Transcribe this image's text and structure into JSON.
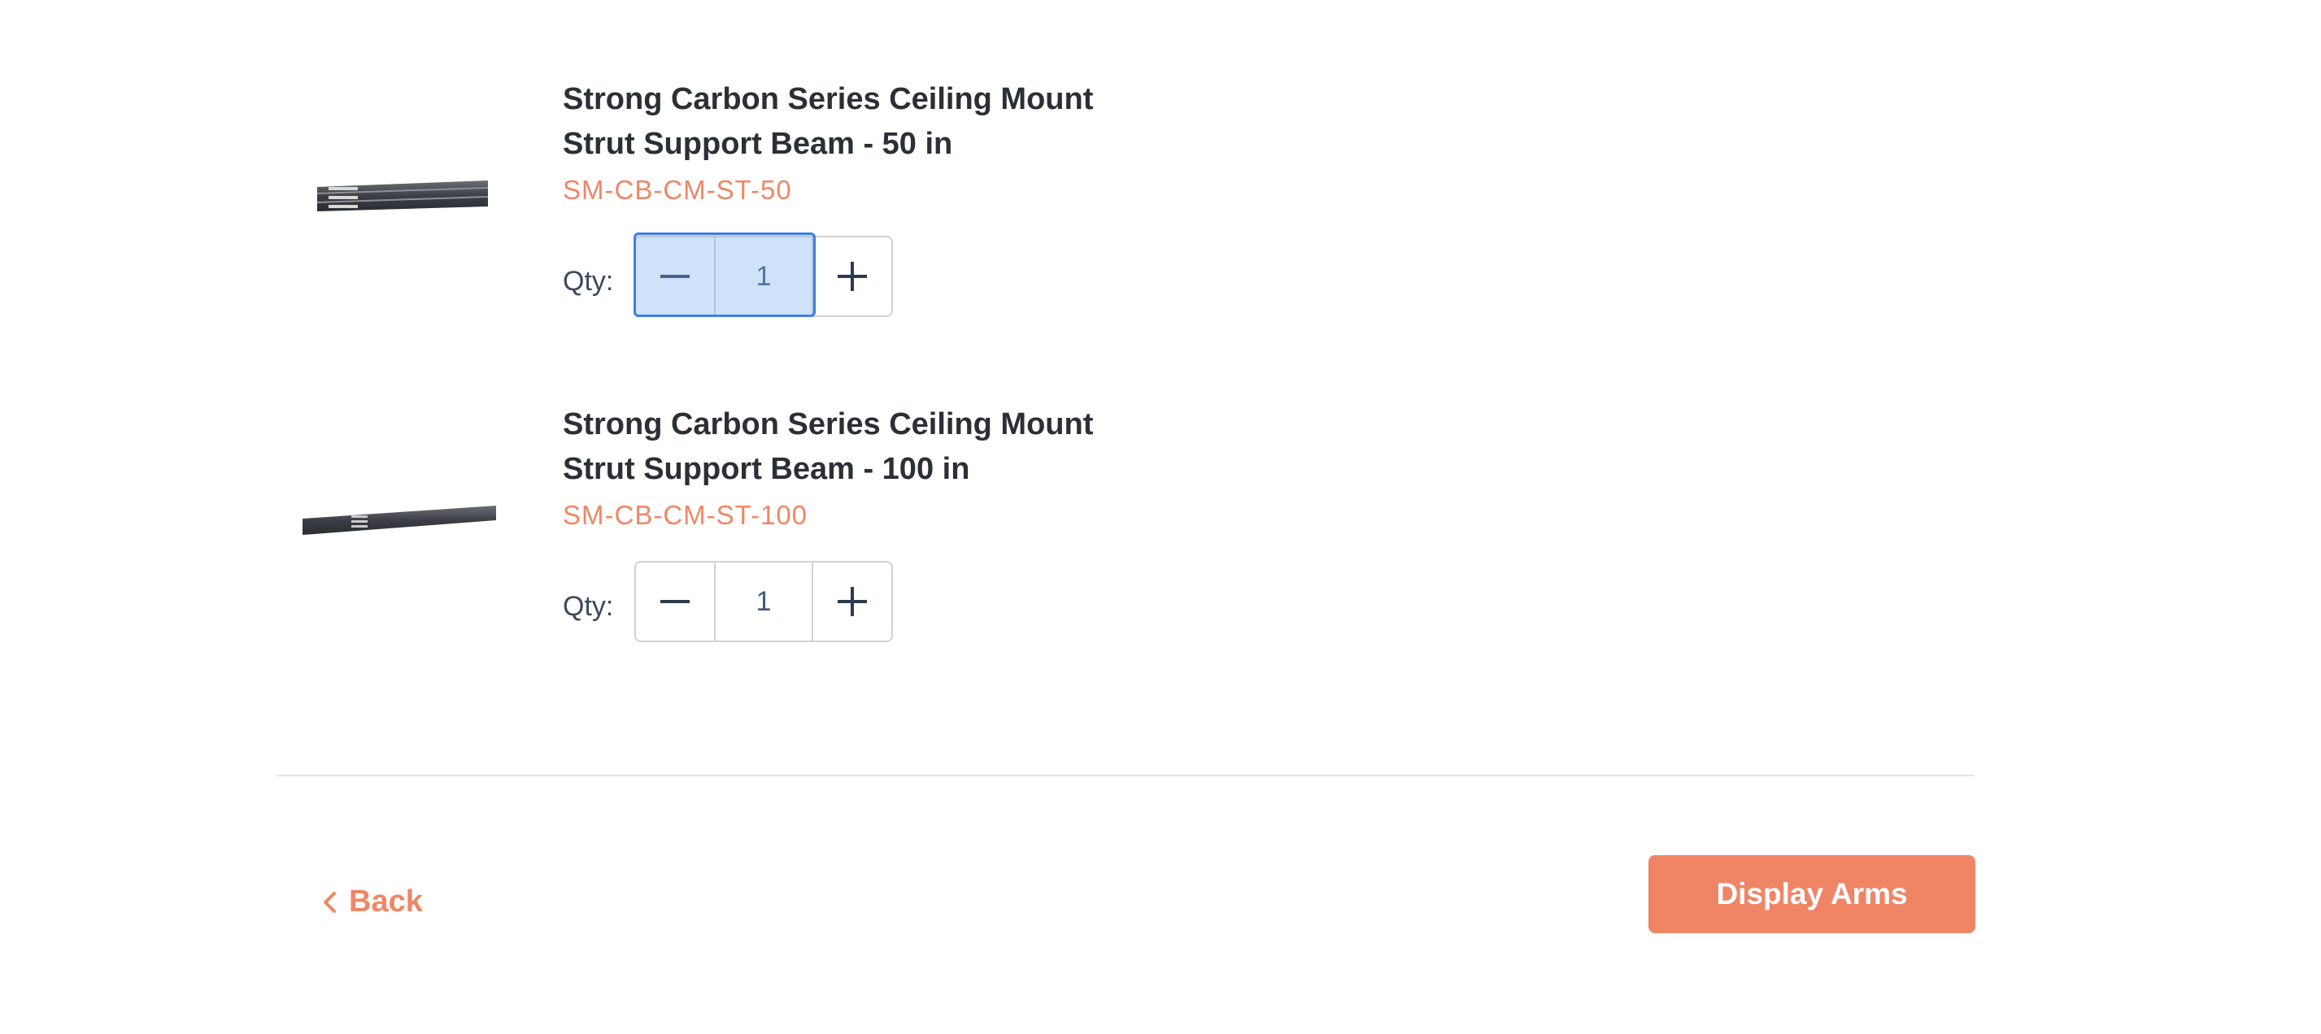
{
  "products": [
    {
      "name_line1": "Strong Carbon Series Ceiling Mount",
      "name_line2": "Strut Support Beam - 50 in",
      "sku": "SM-CB-CM-ST-50",
      "qty_label": "Qty:",
      "qty_value": "1",
      "image_icon": "strut-beam-50-icon"
    },
    {
      "name_line1": "Strong Carbon Series Ceiling Mount",
      "name_line2": "Strut Support Beam - 100 in",
      "sku": "SM-CB-CM-ST-100",
      "qty_label": "Qty:",
      "qty_value": "1",
      "image_icon": "strut-beam-100-icon"
    }
  ],
  "footer": {
    "back_label": "Back",
    "next_label": "Display Arms"
  },
  "colors": {
    "accent": "#ee8766",
    "button_bg": "#f08566",
    "text_dark": "#2b2f36",
    "selection": "#3f7fe0"
  }
}
